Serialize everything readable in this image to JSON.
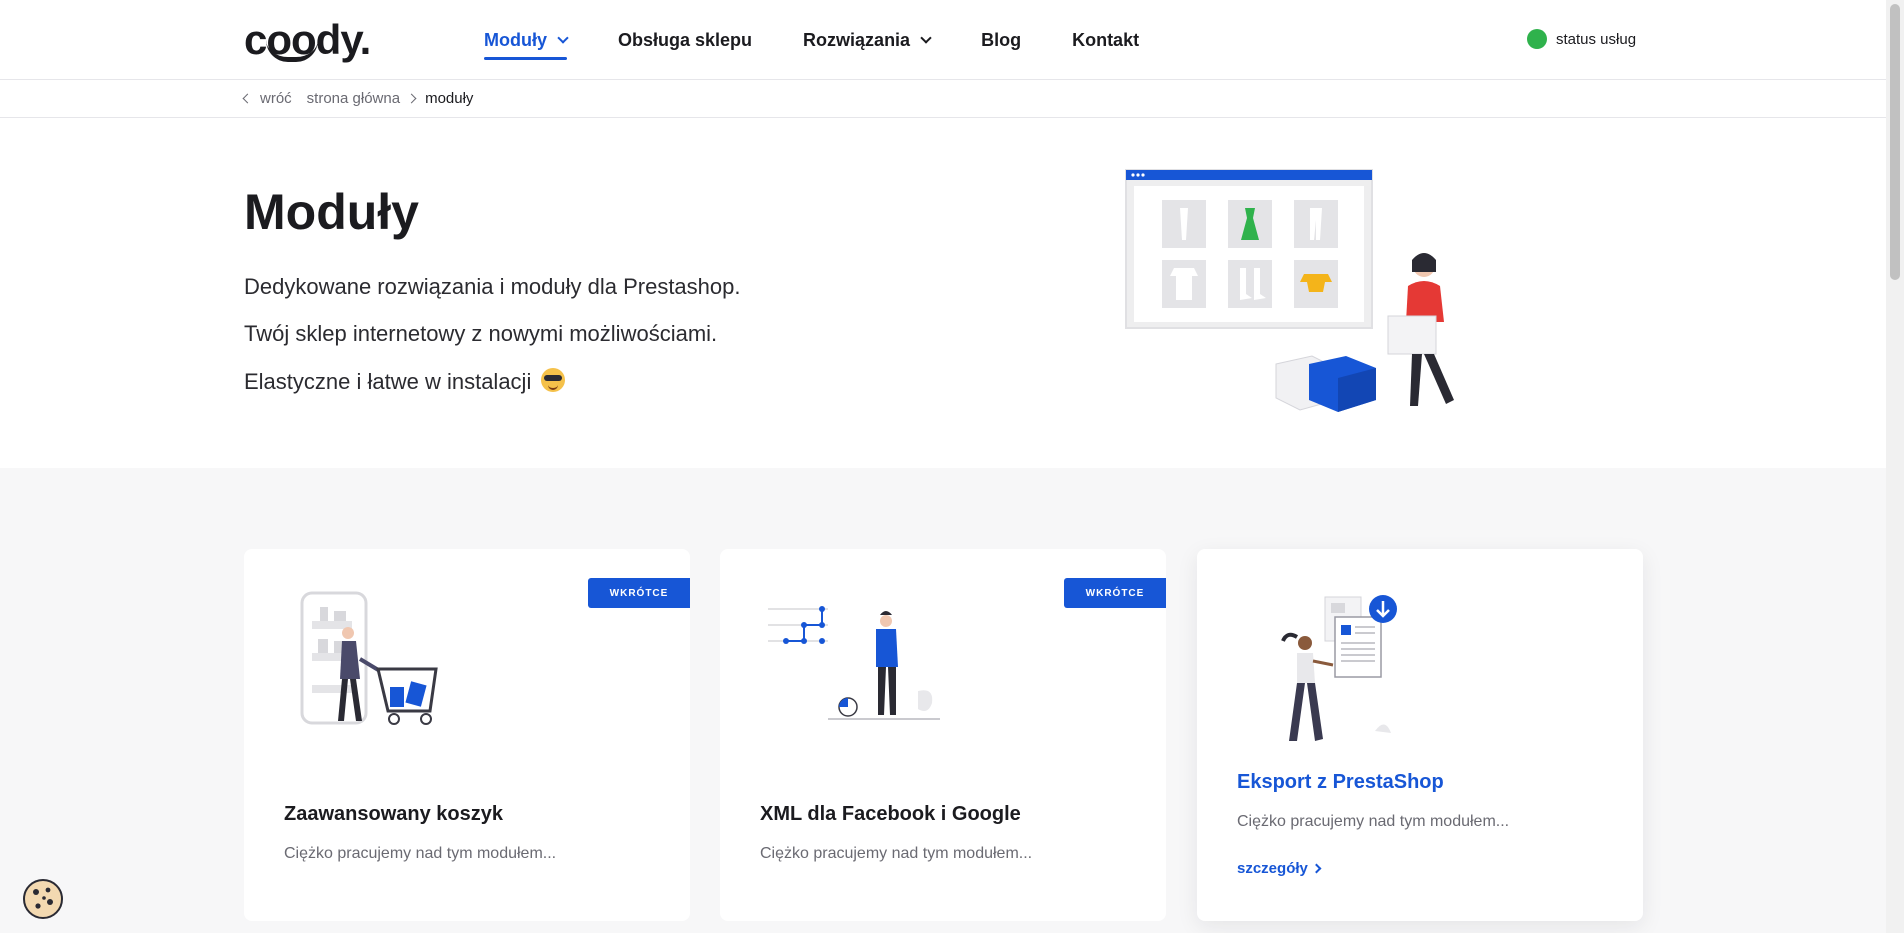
{
  "header": {
    "logo": "coody.",
    "nav": [
      {
        "label": "Moduły",
        "active": true,
        "dropdown": true
      },
      {
        "label": "Obsługa sklepu",
        "active": false,
        "dropdown": false
      },
      {
        "label": "Rozwiązania",
        "active": false,
        "dropdown": true
      },
      {
        "label": "Blog",
        "active": false,
        "dropdown": false
      },
      {
        "label": "Kontakt",
        "active": false,
        "dropdown": false
      }
    ],
    "status_label": "status usług",
    "status_color": "#2fb24c"
  },
  "breadcrumb": {
    "back": "wróć",
    "home": "strona główna",
    "current": "moduły"
  },
  "hero": {
    "title": "Moduły",
    "lines": [
      "Dedykowane rozwiązania i moduły dla Prestashop.",
      "Twój sklep internetowy z nowymi możliwościami.",
      "Elastyczne i łatwe w instalacji"
    ],
    "emoji": "sunglasses-emoji"
  },
  "cards": [
    {
      "badge": "WKRÓTCE",
      "title": "Zaawansowany koszyk",
      "desc": "Ciężko pracujemy nad tym modułem...",
      "illustration": "shopping-cart-illustration"
    },
    {
      "badge": "WKRÓTCE",
      "title": "XML dla Facebook i Google",
      "desc": "Ciężko pracujemy nad tym modułem...",
      "illustration": "data-chart-illustration"
    },
    {
      "title": "Eksport z PrestaShop",
      "desc": "Ciężko pracujemy nad tym modułem...",
      "more": "szczegóły",
      "illustration": "document-export-illustration"
    }
  ],
  "colors": {
    "accent": "#1756d6",
    "background_section": "#f7f7f8",
    "text": "#1b1b1f",
    "status_ok": "#2fb24c"
  },
  "icons": [
    "chevron-down-icon",
    "chevron-left-icon",
    "chevron-right-icon",
    "status-dot-icon",
    "cookie-icon"
  ]
}
